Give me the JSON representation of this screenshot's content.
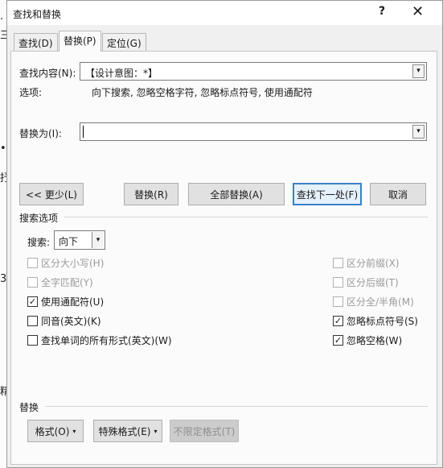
{
  "window": {
    "title": "查找和替换",
    "help_label": "?",
    "close_label": "✕"
  },
  "tabs": [
    {
      "label": "查找(D)",
      "active": false
    },
    {
      "label": "替换(P)",
      "active": true
    },
    {
      "label": "定位(G)",
      "active": false
    }
  ],
  "find": {
    "label": "查找内容(N):",
    "value": "【设计意图：*】"
  },
  "options_row": {
    "label": "选项:",
    "value": "向下搜索, 忽略空格字符, 忽略标点符号, 使用通配符"
  },
  "replace": {
    "label": "替换为(I):",
    "value": ""
  },
  "buttons": {
    "less": "<< 更少(L)",
    "replace": "替换(R)",
    "replace_all": "全部替换(A)",
    "find_next": "查找下一处(F)",
    "cancel": "取消"
  },
  "search_options": {
    "group_label": "搜索选项",
    "direction_label": "搜索:",
    "direction_value": "向下"
  },
  "checkboxes_left": [
    {
      "label": "区分大小写(H)",
      "checked": false,
      "enabled": false
    },
    {
      "label": "全字匹配(Y)",
      "checked": false,
      "enabled": false
    },
    {
      "label": "使用通配符(U)",
      "checked": true,
      "enabled": true
    },
    {
      "label": "同音(英文)(K)",
      "checked": false,
      "enabled": true
    },
    {
      "label": "查找单词的所有形式(英文)(W)",
      "checked": false,
      "enabled": true
    }
  ],
  "checkboxes_right": [
    {
      "label": "区分前缀(X)",
      "checked": false,
      "enabled": false
    },
    {
      "label": "区分后缀(T)",
      "checked": false,
      "enabled": false
    },
    {
      "label": "区分全/半角(M)",
      "checked": false,
      "enabled": false
    },
    {
      "label": "忽略标点符号(S)",
      "checked": true,
      "enabled": true
    },
    {
      "label": "忽略空格(W)",
      "checked": true,
      "enabled": true
    }
  ],
  "replace_section": {
    "group_label": "替换",
    "format": "格式(O)",
    "special": "特殊格式(E)",
    "no_format": "不限定格式(T)"
  },
  "icons": {
    "check": "✓",
    "dropdown": "▾"
  }
}
